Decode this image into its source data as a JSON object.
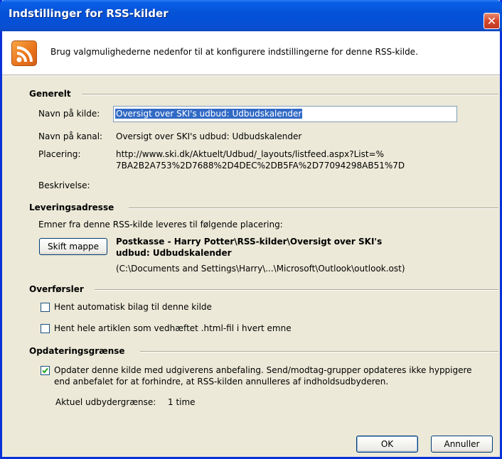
{
  "window": {
    "title": "Indstillinger for RSS-kilder",
    "close_glyph": "✕",
    "header_text": "Brug valgmulighederne nedenfor til at konfigurere indstillingerne for denne RSS-kilde."
  },
  "generelt": {
    "heading": "Generelt",
    "feed_name_label": "Navn på kilde:",
    "feed_name_value": "Oversigt over SKI's udbud: Udbudskalender",
    "channel_name_label": "Navn på kanal:",
    "channel_name_value": "Oversigt over SKI's udbud: Udbudskalender",
    "location_label": "Placering:",
    "location_line1": "http://www.ski.dk/Aktuelt/Udbud/_layouts/listfeed.aspx?List=%",
    "location_line2": "7BA2B2A753%2D7688%2D4DEC%2DB5FA%2D77094298AB51%7D",
    "description_label": "Beskrivelse:"
  },
  "levering": {
    "heading": "Leveringsadresse",
    "intro": "Emner fra denne RSS-kilde leveres til følgende placering:",
    "change_folder_button": "Skift mappe",
    "path_line1": "Postkasse - Harry Potter\\RSS-kilder\\Oversigt over SKI's",
    "path_line2": "udbud: Udbudskalender",
    "file_path": "(C:\\Documents and Settings\\Harry\\...\\Microsoft\\Outlook\\outlook.ost)"
  },
  "overforsler": {
    "heading": "Overførsler",
    "option1": "Hent automatisk bilag til denne kilde",
    "option2": "Hent hele artiklen som vedhæftet .html-fil i hvert emne"
  },
  "opdatering": {
    "heading": "Opdateringsgrænse",
    "option_line1": "Opdater denne kilde med udgiverens anbefaling. Send/modtag-grupper opdateres ikke hyppigere",
    "option_line2": "end anbefalet for at forhindre, at RSS-kilden annulleres af indholdsudbyderen.",
    "current_limit_label": "Aktuel udbydergrænse:",
    "current_limit_value": "1 time"
  },
  "buttons": {
    "ok": "OK",
    "cancel": "Annuller"
  },
  "colors": {
    "titlebar": "#0553d6",
    "dialog_bg": "#ece9d8",
    "rss_orange": "#e8721a"
  },
  "icons": {
    "feed": "rss-icon",
    "close": "close-icon",
    "check": "checkmark-icon"
  }
}
